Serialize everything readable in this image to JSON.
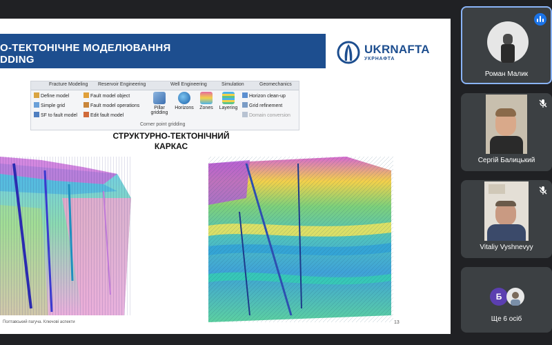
{
  "slide": {
    "title_line1": "О-ТЕКТОНІЧНЕ МОДЕЛЮВАННЯ",
    "title_line2": "DDING",
    "logo_text": "UKRNAFTA",
    "logo_subtext": "УКРНАФТА",
    "caption_line1": "СТРУКТУРНО-ТЕКТОНІЧНИЙ",
    "caption_line2": "КАРКАС",
    "footer_text": "Полтавський пагуча. Ключові аспекти",
    "page_number": "13"
  },
  "ribbon": {
    "tabs": [
      "Fracture Modeling",
      "Reservoir Engineering",
      "Well Engineering",
      "Simulation",
      "Geomechanics"
    ],
    "left_commands": [
      "Define model",
      "Simple grid",
      "SF to fault model"
    ],
    "mid_commands": [
      "Fault model object",
      "Fault model operations",
      "Edit fault model"
    ],
    "big_buttons": [
      "Pillar gridding",
      "Horizons",
      "Zones",
      "Layering"
    ],
    "right_commands": [
      "Horizon clean-up",
      "Grid refinement",
      "Domain conversion"
    ],
    "group_label": "Corner point gridding"
  },
  "participants": [
    {
      "name": "Роман Малик",
      "speaking": true
    },
    {
      "name": "Сергій Балицький",
      "muted": true
    },
    {
      "name": "Vitaliy Vyshnevyy",
      "muted": true
    }
  ],
  "more": {
    "avatar_letter": "Б",
    "label": "Ще 6 осіб"
  },
  "colors": {
    "title_band": "#1d4e8f",
    "speaking_accent": "#1a73e8",
    "tile_bg": "#3c4043",
    "app_bg": "#202124"
  }
}
